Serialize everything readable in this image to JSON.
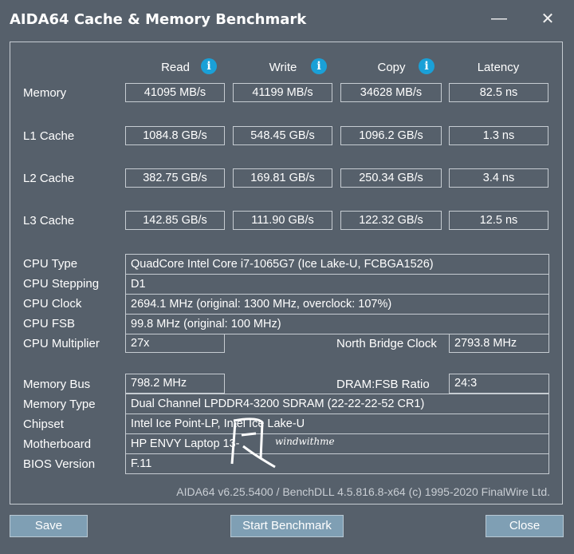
{
  "window": {
    "title": "AIDA64 Cache & Memory Benchmark",
    "minimize_icon": "minimize-icon",
    "close_icon": "close-icon"
  },
  "columns": [
    {
      "label": "Read",
      "info": "i"
    },
    {
      "label": "Write",
      "info": "i"
    },
    {
      "label": "Copy",
      "info": "i"
    },
    {
      "label": "Latency"
    }
  ],
  "bench_rows": [
    {
      "label": "Memory",
      "read": "41095 MB/s",
      "write": "41199 MB/s",
      "copy": "34628 MB/s",
      "latency": "82.5 ns"
    },
    {
      "label": "L1 Cache",
      "read": "1084.8 GB/s",
      "write": "548.45 GB/s",
      "copy": "1096.2 GB/s",
      "latency": "1.3 ns"
    },
    {
      "label": "L2 Cache",
      "read": "382.75 GB/s",
      "write": "169.81 GB/s",
      "copy": "250.34 GB/s",
      "latency": "3.4 ns"
    },
    {
      "label": "L3 Cache",
      "read": "142.85 GB/s",
      "write": "111.90 GB/s",
      "copy": "122.32 GB/s",
      "latency": "12.5 ns"
    }
  ],
  "cpu": {
    "type_label": "CPU Type",
    "type_value": "QuadCore Intel Core i7-1065G7  (Ice Lake-U, FCBGA1526)",
    "stepping_label": "CPU Stepping",
    "stepping_value": "D1",
    "clock_label": "CPU Clock",
    "clock_value": "2694.1 MHz  (original: 1300 MHz, overclock: 107%)",
    "fsb_label": "CPU FSB",
    "fsb_value": "99.8 MHz  (original: 100 MHz)",
    "multiplier_label": "CPU Multiplier",
    "multiplier_value": "27x",
    "nb_clock_label": "North Bridge Clock",
    "nb_clock_value": "2793.8 MHz"
  },
  "memory": {
    "bus_label": "Memory Bus",
    "bus_value": "798.2 MHz",
    "ratio_label": "DRAM:FSB Ratio",
    "ratio_value": "24:3",
    "type_label": "Memory Type",
    "type_value": "Dual Channel LPDDR4-3200 SDRAM  (22-22-22-52 CR1)",
    "chipset_label": "Chipset",
    "chipset_value": "Intel Ice Point-LP, Intel Ice Lake-U",
    "motherboard_label": "Motherboard",
    "motherboard_value": "HP ENVY Laptop 13-",
    "bios_label": "BIOS Version",
    "bios_value": "F.11"
  },
  "footer": {
    "version_text": "AIDA64 v6.25.5400 / BenchDLL 4.5.816.8-x64  (c) 1995-2020 FinalWire Ltd."
  },
  "buttons": {
    "save": "Save",
    "start": "Start Benchmark",
    "close": "Close"
  },
  "watermark": {
    "text": "windwithme"
  }
}
